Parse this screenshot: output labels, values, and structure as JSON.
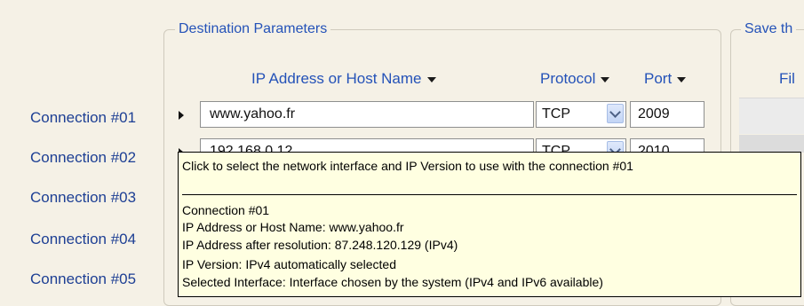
{
  "group_destination": {
    "title": "Destination Parameters"
  },
  "group_save": {
    "title": "Save th",
    "column_header": "Fil"
  },
  "headers": {
    "host": "IP Address or Host Name",
    "protocol": "Protocol",
    "port": "Port"
  },
  "connections": [
    {
      "label": "Connection #01",
      "host": "www.yahoo.fr",
      "protocol": "TCP",
      "port": "2009"
    },
    {
      "label": "Connection #02",
      "host": "192.168.0.12",
      "protocol": "TCP",
      "port": "2010"
    },
    {
      "label": "Connection #03"
    },
    {
      "label": "Connection #04"
    },
    {
      "label": "Connection #05"
    }
  ],
  "tooltip": {
    "title": "Click to select the network interface and IP Version to use with the connection #01",
    "lines": [
      "Connection #01",
      "IP Address or Host Name: www.yahoo.fr",
      "IP Address after resolution: 87.248.120.129 (IPv4)",
      "IP Version: IPv4 automatically selected",
      "Selected Interface: Interface chosen by the system (IPv4 and IPv6 available)"
    ]
  },
  "colors": {
    "background": "#f5f1e6",
    "accent_text": "#2452b8",
    "label_text": "#1d3f94",
    "tooltip_bg": "#ffffe1"
  }
}
